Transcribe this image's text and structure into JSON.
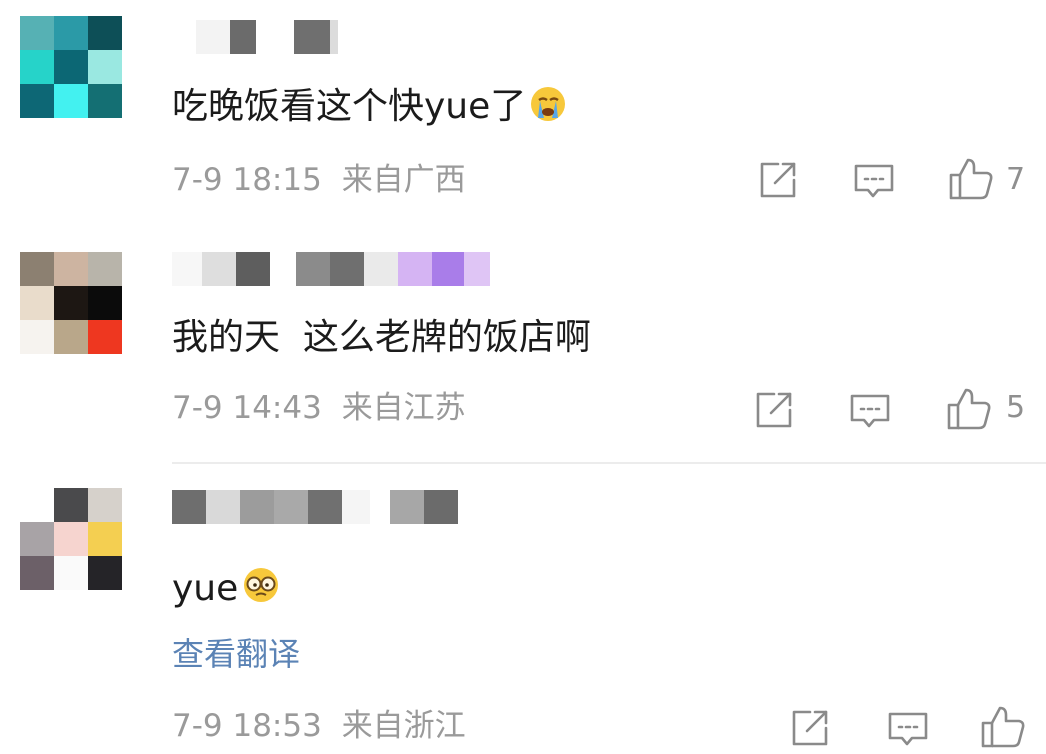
{
  "comments": [
    {
      "text": "吃晚饭看这个快yue了",
      "emoji": "crying-face",
      "date": "7-9 18:15",
      "location": "来自广西",
      "likes": "7",
      "avatar_colors": [
        "#56b1b4",
        "#2b9aa7",
        "#0d4f57",
        "#26d3c9",
        "#0c6774",
        "#9ae8e1",
        "#0d6775",
        "#43f1f0",
        "#146f73"
      ],
      "name_blocks": [
        "#ffffff",
        "#f3f3f3",
        "#6b6b6b",
        "#ffffff",
        "#6f6f6f",
        "#dcdcdc"
      ]
    },
    {
      "text": "我的天  这么老牌的饭店啊",
      "date": "7-9 14:43",
      "location": "来自江苏",
      "likes": "5",
      "avatar_colors": [
        "#8c8071",
        "#cdb4a1",
        "#b8b4aa",
        "#e9dccb",
        "#1d1713",
        "#0b0b0b",
        "#f6f3ef",
        "#b9a78a",
        "#ee3720"
      ],
      "name_blocks": [
        "#f7f7f7",
        "#dedede",
        "#5e5e5e",
        "#ffffff",
        "#8b8b8b",
        "#6f6f6f",
        "#eaeaea",
        "#d5b4f3",
        "#a97de9",
        "#dfc5f5"
      ]
    },
    {
      "text": "yue",
      "emoji": "glasses-face",
      "translate": "查看翻译",
      "date": "7-9 18:53",
      "location": "来自浙江",
      "avatar_colors": [
        "#ffffff",
        "#4a4a4c",
        "#d6d1cb",
        "#a8a3a6",
        "#f6d4cf",
        "#f4cf51",
        "#6c6068",
        "#fafafa",
        "#252428"
      ],
      "name_blocks": [
        "#6e6e6e",
        "#d9d9d9",
        "#9c9c9c",
        "#a9a9a9",
        "#707070",
        "#f5f5f5",
        "#ffffff",
        "#a7a7a7",
        "#6b6b6b"
      ]
    }
  ],
  "icons": {
    "repost": "share-icon",
    "comment": "comment-icon",
    "like": "thumbs-up-icon"
  },
  "colors": {
    "meta_text": "#9a9a9a",
    "translate_link": "#5b83b5",
    "icon_stroke": "#8a8a8a"
  }
}
